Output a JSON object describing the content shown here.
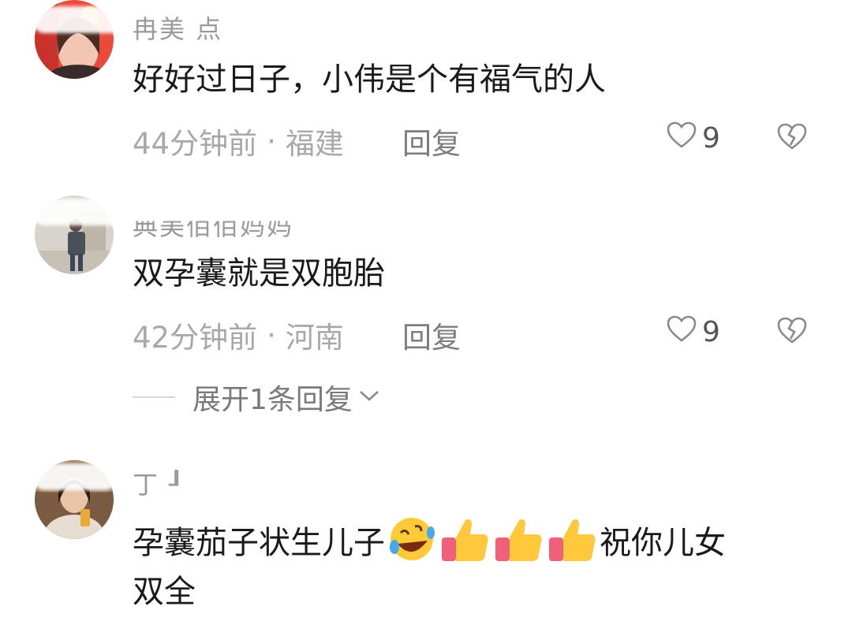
{
  "comments": [
    {
      "username": "冉美  点",
      "text": "好好过日子，小伟是个有福气的人",
      "time": "44分钟前",
      "separator": "·",
      "location": "福建",
      "reply_label": "回复",
      "likes": "9",
      "avatar_icon": "avatar-woman-red-background"
    },
    {
      "username": "典美佰佰妈妈",
      "text": "双孕囊就是双胞胎",
      "time": "42分钟前",
      "separator": "·",
      "location": "河南",
      "reply_label": "回复",
      "likes": "9",
      "avatar_icon": "avatar-person-room",
      "expand_label": "展开1条回复"
    },
    {
      "username": "丁 ┚",
      "text_before": "孕囊茄子状生儿子",
      "emojis": [
        "rolling-laughing-emoji",
        "thumbs-up-emoji",
        "thumbs-up-emoji",
        "thumbs-up-emoji"
      ],
      "text_after": "祝你儿女",
      "text_line2": "双全",
      "avatar_icon": "avatar-girl-drink"
    }
  ],
  "icons": {
    "like": "heart-outline-icon",
    "dislike": "broken-heart-icon",
    "expand": "chevron-down-icon"
  },
  "colors": {
    "text_primary": "#1a1a1a",
    "text_secondary": "#a8a8a8",
    "thumb_yellow": "#ffc83d",
    "sleeve_pink": "#f0607a"
  }
}
